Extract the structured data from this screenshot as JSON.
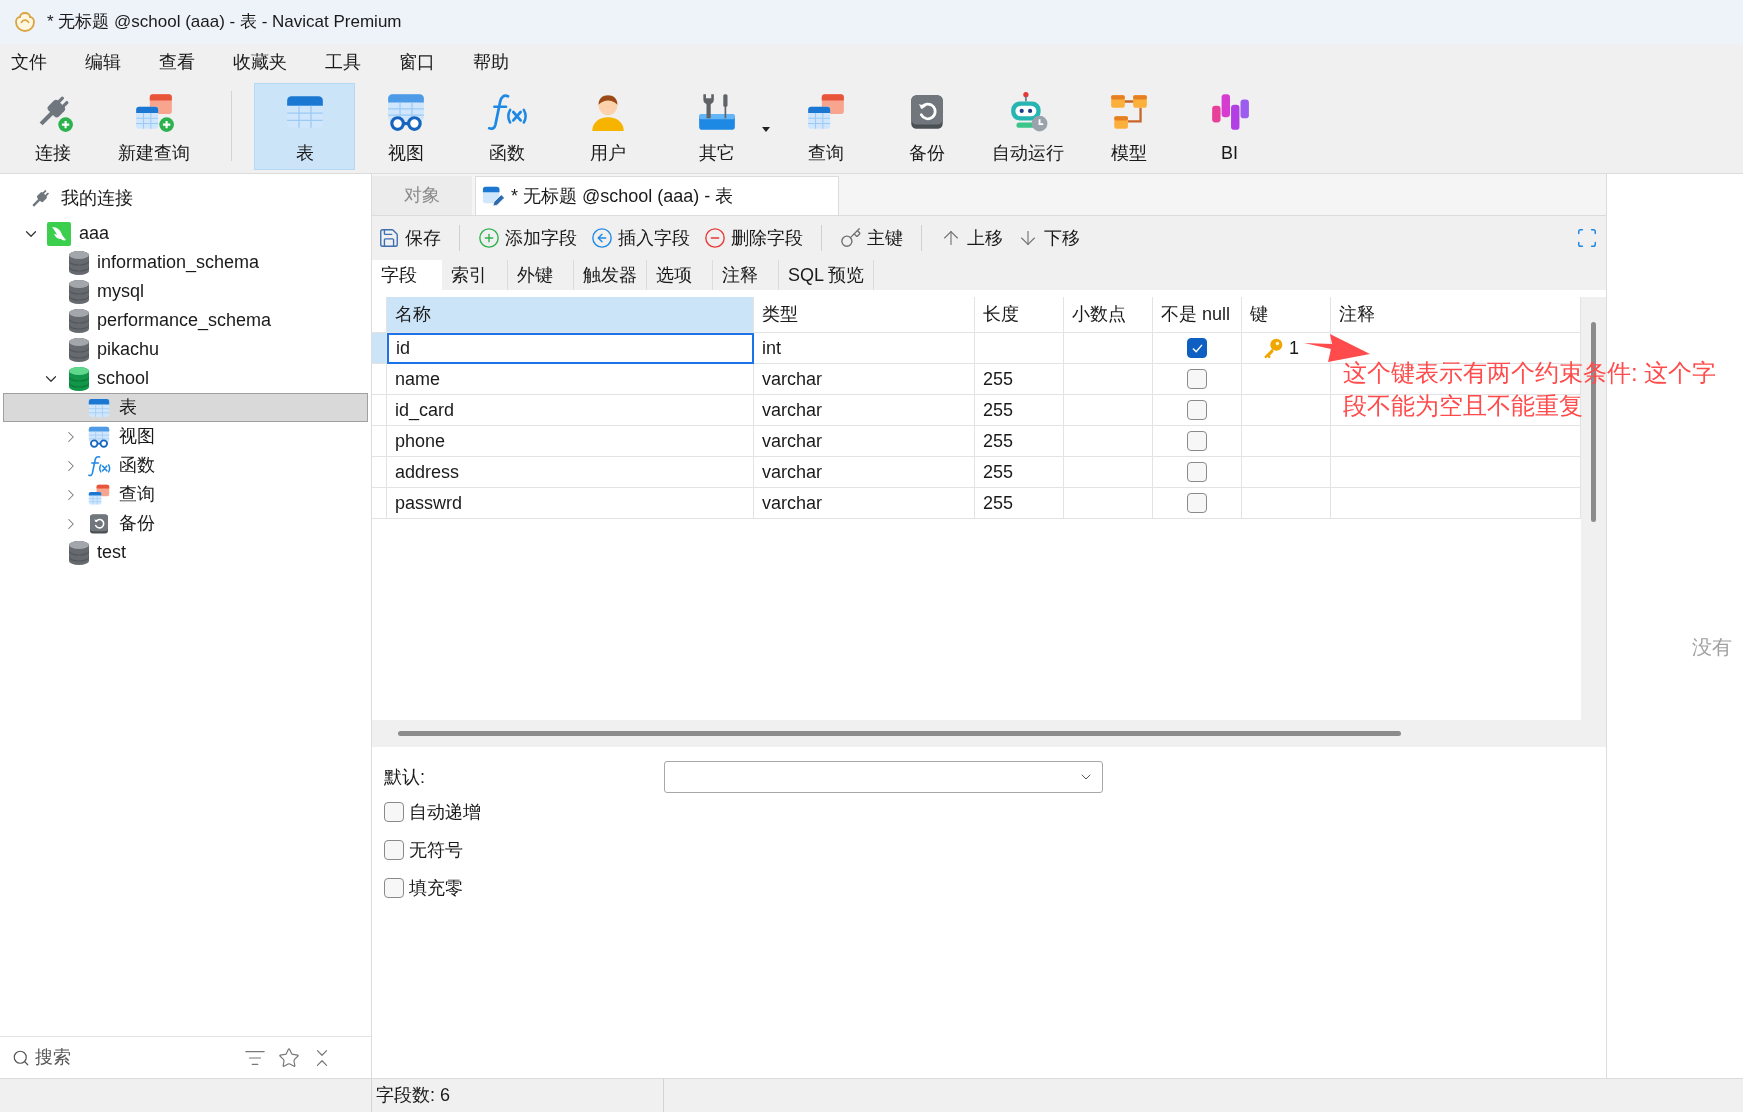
{
  "window": {
    "title": "* 无标题 @school (aaa) - 表 - Navicat Premium"
  },
  "menu": [
    "文件",
    "编辑",
    "查看",
    "收藏夹",
    "工具",
    "窗口",
    "帮助"
  ],
  "toolbar": {
    "groups": [
      [
        {
          "label": "连接",
          "kind": "connect",
          "selected": false,
          "dropdown": false
        },
        {
          "label": "新建查询",
          "kind": "new_query",
          "selected": false,
          "dropdown": false
        }
      ],
      [
        {
          "label": "表",
          "kind": "table",
          "selected": true,
          "dropdown": false
        },
        {
          "label": "视图",
          "kind": "view",
          "selected": false,
          "dropdown": false
        },
        {
          "label": "函数",
          "kind": "function",
          "selected": false,
          "dropdown": false
        },
        {
          "label": "用户",
          "kind": "user",
          "selected": false,
          "dropdown": false
        },
        {
          "label": "其它",
          "kind": "other",
          "selected": false,
          "dropdown": true
        },
        {
          "label": "查询",
          "kind": "query",
          "selected": false,
          "dropdown": false
        },
        {
          "label": "备份",
          "kind": "backup",
          "selected": false,
          "dropdown": false
        },
        {
          "label": "自动运行",
          "kind": "automation",
          "selected": false,
          "dropdown": false
        },
        {
          "label": "模型",
          "kind": "model",
          "selected": false,
          "dropdown": false
        },
        {
          "label": "BI",
          "kind": "bi",
          "selected": false,
          "dropdown": false
        }
      ]
    ]
  },
  "sidebar": {
    "header": "我的连接",
    "tree": [
      {
        "label": "aaa",
        "kind": "connection",
        "expanded": true,
        "selected": false,
        "children": [
          {
            "label": "information_schema",
            "kind": "database",
            "open": false,
            "selected": false
          },
          {
            "label": "mysql",
            "kind": "database",
            "open": false,
            "selected": false
          },
          {
            "label": "performance_schema",
            "kind": "database",
            "open": false,
            "selected": false
          },
          {
            "label": "pikachu",
            "kind": "database",
            "open": false,
            "selected": false
          },
          {
            "label": "school",
            "kind": "database",
            "open": true,
            "expanded": true,
            "selected": false,
            "children": [
              {
                "label": "表",
                "kind": "tables",
                "selected": true
              },
              {
                "label": "视图",
                "kind": "views",
                "expanded": false,
                "selected": false
              },
              {
                "label": "函数",
                "kind": "functions",
                "expanded": false,
                "selected": false
              },
              {
                "label": "查询",
                "kind": "queries",
                "expanded": false,
                "selected": false
              },
              {
                "label": "备份",
                "kind": "backups",
                "expanded": false,
                "selected": false
              }
            ]
          },
          {
            "label": "test",
            "kind": "database",
            "open": false,
            "selected": false
          }
        ]
      }
    ],
    "search": {
      "placeholder": "搜索"
    }
  },
  "editor": {
    "tabs": [
      {
        "label": "对象",
        "kind": "objects",
        "selected": false
      },
      {
        "label": "* 无标题 @school (aaa) - 表",
        "kind": "table_design",
        "selected": true
      }
    ],
    "actions": [
      [
        {
          "label": "保存",
          "kind": "save"
        }
      ],
      [
        {
          "label": "添加字段",
          "kind": "add"
        },
        {
          "label": "插入字段",
          "kind": "insert"
        },
        {
          "label": "删除字段",
          "kind": "delete"
        }
      ],
      [
        {
          "label": "主键",
          "kind": "primary_key"
        }
      ],
      [
        {
          "label": "上移",
          "kind": "move_up"
        },
        {
          "label": "下移",
          "kind": "move_down"
        }
      ]
    ],
    "subtabs": [
      {
        "label": "字段",
        "selected": true
      },
      {
        "label": "索引",
        "selected": false
      },
      {
        "label": "外键",
        "selected": false
      },
      {
        "label": "触发器",
        "selected": false
      },
      {
        "label": "选项",
        "selected": false
      },
      {
        "label": "注释",
        "selected": false
      },
      {
        "label": "SQL 预览",
        "selected": false
      }
    ],
    "grid": {
      "columns": [
        {
          "label": "名称",
          "selected": true
        },
        {
          "label": "类型",
          "selected": false
        },
        {
          "label": "长度",
          "selected": false
        },
        {
          "label": "小数点",
          "selected": false
        },
        {
          "label": "不是 null",
          "selected": false
        },
        {
          "label": "键",
          "selected": false
        },
        {
          "label": "注释",
          "selected": false
        }
      ],
      "rows": [
        {
          "name": "id",
          "type": "int",
          "not_null": true,
          "key": "1",
          "selected": true
        },
        {
          "name": "name",
          "type": "varchar",
          "length": "255",
          "not_null": false,
          "selected": false
        },
        {
          "name": "id_card",
          "type": "varchar",
          "length": "255",
          "not_null": false,
          "selected": false
        },
        {
          "name": "phone",
          "type": "varchar",
          "length": "255",
          "not_null": false,
          "selected": false
        },
        {
          "name": "address",
          "type": "varchar",
          "length": "255",
          "not_null": false,
          "selected": false
        },
        {
          "name": "passwrd",
          "type": "varchar",
          "length": "255",
          "not_null": false,
          "selected": false
        }
      ]
    },
    "annotation": {
      "text": "这个键表示有两个约束条件: 这个字段不能为空且不能重复"
    },
    "properties": {
      "default_label": "默认:",
      "options": [
        {
          "label": "自动递增",
          "checked": false
        },
        {
          "label": "无符号",
          "checked": false
        },
        {
          "label": "填充零",
          "checked": false
        }
      ]
    }
  },
  "info_panel": {
    "text": "没有"
  },
  "status_bar": {
    "text": "字段数: 6"
  }
}
